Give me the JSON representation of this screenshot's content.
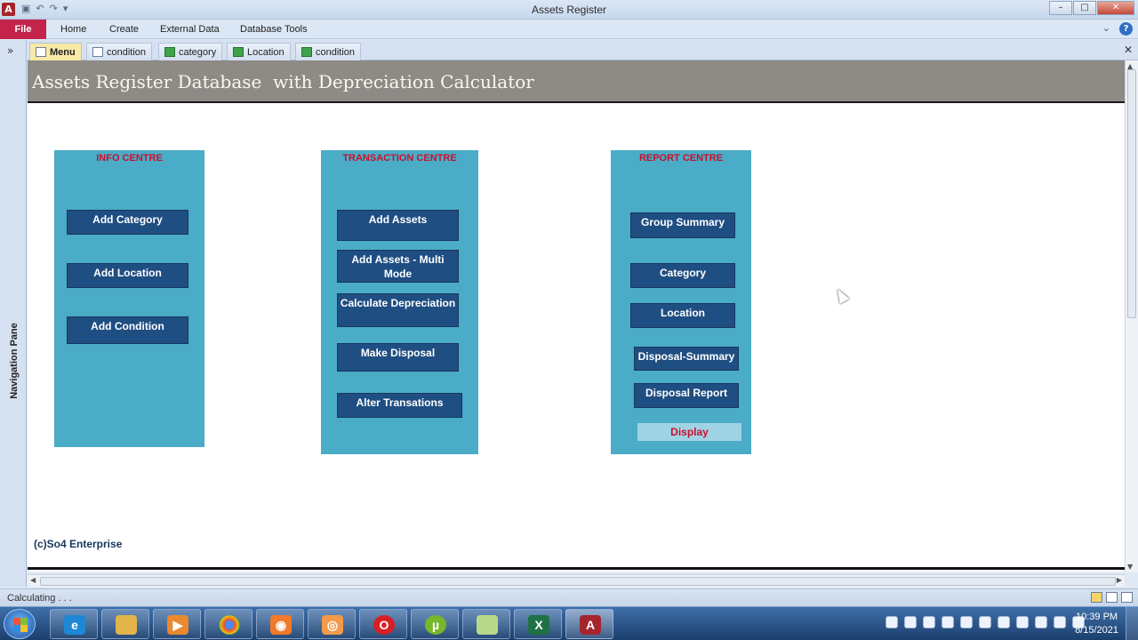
{
  "window": {
    "title": "Assets Register",
    "app_icon": "A",
    "buttons": [
      "–",
      "□",
      "✕"
    ]
  },
  "ribbon": {
    "file": "File",
    "tabs": [
      "Home",
      "Create",
      "External Data",
      "Database Tools"
    ],
    "help": "?"
  },
  "nav_pane": {
    "label": "Navigation Pane",
    "expand": "»"
  },
  "doc_tabs": [
    {
      "label": "Menu",
      "icon": "form-icon"
    },
    {
      "label": "condition",
      "icon": "form-icon"
    },
    {
      "label": "category",
      "icon": "table-icon"
    },
    {
      "label": "Location",
      "icon": "table-icon"
    },
    {
      "label": "condition",
      "icon": "table-icon"
    }
  ],
  "doc_close": "✕",
  "form": {
    "title": "Assets Register Database  with Depreciation Calculator",
    "copyright": "(c)So4 Enterprise",
    "info": {
      "title": "INFO CENTRE",
      "buttons": [
        "Add Category",
        "Add Location",
        "Add Condition"
      ]
    },
    "transaction": {
      "title": "TRANSACTION CENTRE",
      "buttons": [
        "Add Assets",
        "Add Assets - Multi Mode",
        "Calculate Depreciation",
        "Make Disposal",
        "Alter Transations"
      ]
    },
    "report": {
      "title": "REPORT CENTRE",
      "buttons": [
        "Group Summary",
        "Category",
        "Location",
        "Disposal-Summary",
        "Disposal Report",
        "Display"
      ]
    }
  },
  "status": {
    "text": "Calculating . . ."
  },
  "taskbar": {
    "clock_time": "10:39 PM",
    "clock_date": "8/15/2021"
  },
  "colors": {
    "panel": "#4aacc6",
    "button": "#1f4e82",
    "panel_title": "#c8102e",
    "header": "#8e8a86"
  }
}
